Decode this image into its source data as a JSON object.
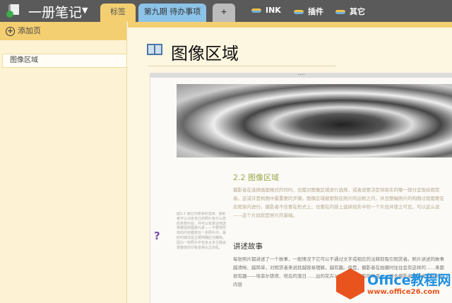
{
  "topbar": {
    "notebook_title": "一册笔记",
    "tabs": [
      {
        "label": "标签"
      },
      {
        "label": "第九期 待办事项"
      },
      {
        "label": "+"
      }
    ],
    "menus": [
      {
        "label": "INK"
      },
      {
        "label": "插件"
      },
      {
        "label": "其它"
      }
    ]
  },
  "sidebar": {
    "add_page": "添加页",
    "pages": [
      {
        "label": "图像区域"
      }
    ]
  },
  "page": {
    "title": "图像区域",
    "handle": "....",
    "help": "?"
  },
  "scan": {
    "section": "2.2 图像区域",
    "para1": "摄影者在选择画面格式的同时，也需对图像区域进行选择，或者说要决定将现实的哪一部分呈现给观赏者。这或许是构图中最重要的步骤。图像区域被限制在照片的边框之内，并且整幅照片的构图过程都要在此框架内进行。摄影者不仅要在形式上，也要在内容上选择现实中的一个片段并使之可见，可以这么说——这个片段就是照片的基础。",
    "caption": "图2.2 通过对叙事的选择，摄影者可以决定自己的照片有什么样的意想内容，并可以有意识地选择被拍的图像元素——不要将所有的内容都放在一张照片中。最好的做法是主题明确应当精炼，因为一张照片中包含太多主题会使整体的印象变得太过杂乱。",
    "subheading": "讲述故事",
    "para2": "每张照片都讲述了一个故事，一般情况下它可以不通过文字或相应的注释就吸引观赏者。照片讲述的故事越清晰、越简单，对观赏者来说就越容易理解，越有趣。但是，摄影者在拍摄时往往会有这样的……来都很有趣——埃菲尔铁塔、塔后的落日……边的花卉以及摄影者面前的导游——很多摄影者都会尝试将所有内容"
  },
  "watermark": {
    "text": "Office教程网",
    "url": "www.office26.com"
  }
}
